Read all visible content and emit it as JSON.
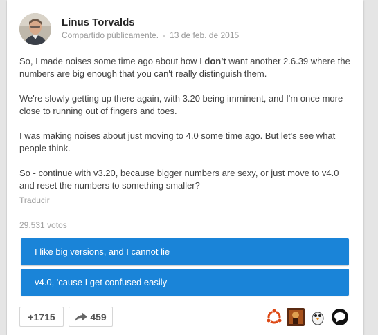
{
  "post": {
    "author": "Linus Torvalds",
    "visibility": "Compartido públicamente.",
    "separator": "-",
    "date": "13 de feb. de 2015",
    "paragraphs": [
      {
        "before": "So, I made noises some time ago about how I ",
        "bold": "don't",
        "after": " want another 2.6.39 where the numbers are big enough that you can't really distinguish them."
      },
      {
        "text": "We're slowly getting up there again, with 3.20 being imminent, and I'm once more close to running out of fingers and toes."
      },
      {
        "text": "I was making noises about just moving to 4.0 some time ago. But let's see what people think."
      },
      {
        "text": "So - continue with v3.20, because bigger numbers are sexy, or just move to v4.0 and reset the numbers to something smaller?"
      }
    ],
    "translate_label": "Traducir"
  },
  "poll": {
    "votes": "29.531 votos",
    "options": [
      {
        "label": "I like big versions, and I cannot lie"
      },
      {
        "label": "v4.0, 'cause I get confused easily"
      }
    ],
    "option_color": "#1a84d8"
  },
  "actions": {
    "plus_count": "+1715",
    "share_count": "459",
    "share_icon": "share-arrow-icon",
    "sharers": [
      "ubuntu-avatar",
      "illustration-avatar",
      "penguin-avatar",
      "speech-bubble-avatar"
    ]
  }
}
